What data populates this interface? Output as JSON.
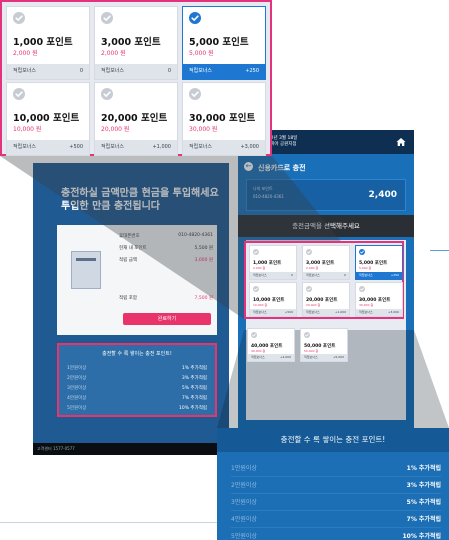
{
  "point_grid": {
    "tiles": [
      {
        "amount": "1,000 포인트",
        "price": "2,000 원",
        "bonus_label": "적립보너스",
        "bonus_value": "0",
        "selected": false
      },
      {
        "amount": "3,000 포인트",
        "price": "2,000 원",
        "bonus_label": "적립보너스",
        "bonus_value": "0",
        "selected": false
      },
      {
        "amount": "5,000 포인트",
        "price": "5,000 원",
        "bonus_label": "적립보너스",
        "bonus_value": "+250",
        "selected": true
      },
      {
        "amount": "10,000 포인트",
        "price": "10,000 원",
        "bonus_label": "적립보너스",
        "bonus_value": "+500",
        "selected": false
      },
      {
        "amount": "20,000 포인트",
        "price": "20,000 원",
        "bonus_label": "적립보너스",
        "bonus_value": "+1,000",
        "selected": false
      },
      {
        "amount": "30,000 포인트",
        "price": "30,000 원",
        "bonus_label": "적립보너스",
        "bonus_value": "+3,000",
        "selected": false
      }
    ],
    "extra_tiles": [
      {
        "amount": "40,000 포인트",
        "price": "40,000 원",
        "bonus_label": "적립보너스",
        "bonus_value": "+4,000"
      },
      {
        "amount": "50,000 포인트",
        "price": "50,000 원",
        "bonus_label": "적립보너스",
        "bonus_value": "+5,000"
      }
    ]
  },
  "left_screen": {
    "title_line1": "충전하실 금액만큼 현금을 투입해세요",
    "title_line2": "투입한 만큼 충전됩니다",
    "info": [
      {
        "label": "휴대폰번호",
        "value": "010-4820-4361"
      },
      {
        "label": "현재 내 포인트",
        "value": "5,500 원"
      },
      {
        "label": "적립 금액",
        "value": "3,000 원"
      },
      {
        "label": "적립 포함",
        "value": "7,500 원"
      }
    ],
    "pay_button": "완료하기",
    "bonus_title": "충전할 수 록 쌓이는 충전 포인트!",
    "bonus_rows": [
      {
        "label": "1만원이상",
        "pct": "1% 추가적립"
      },
      {
        "label": "2만원이상",
        "pct": "3% 추가적립"
      },
      {
        "label": "3만원이상",
        "pct": "5% 추가적립"
      },
      {
        "label": "4만원이상",
        "pct": "7% 추가적립"
      },
      {
        "label": "5만원이상",
        "pct": "10% 추가적립"
      }
    ],
    "footer": "고객센터 1577-0577"
  },
  "right_screen": {
    "top_date": "2022년 3월 18일",
    "top_sub": "에이피아 공원지점",
    "page_title": "신용카드로 충전",
    "card_label": "나의 포인트",
    "card_number": "010-4820-4361",
    "balance": "2,400",
    "select_prompt": "충전금액을 선택해주세요"
  },
  "bonus_panel": {
    "title": "충전할 수 록 쌓이는 충전 포인트!",
    "rows": [
      {
        "label": "1만원이상",
        "pct": "1% 추가적립"
      },
      {
        "label": "2만원이상",
        "pct": "3% 추가적립"
      },
      {
        "label": "3만원이상",
        "pct": "5% 추가적립"
      },
      {
        "label": "4만원이상",
        "pct": "7% 추가적립"
      },
      {
        "label": "5만원이상",
        "pct": "10% 추가적립"
      }
    ]
  },
  "colors": {
    "accent_pink": "#e3327e",
    "accent_blue": "#1e78d2",
    "price_red": "#e8336b"
  }
}
